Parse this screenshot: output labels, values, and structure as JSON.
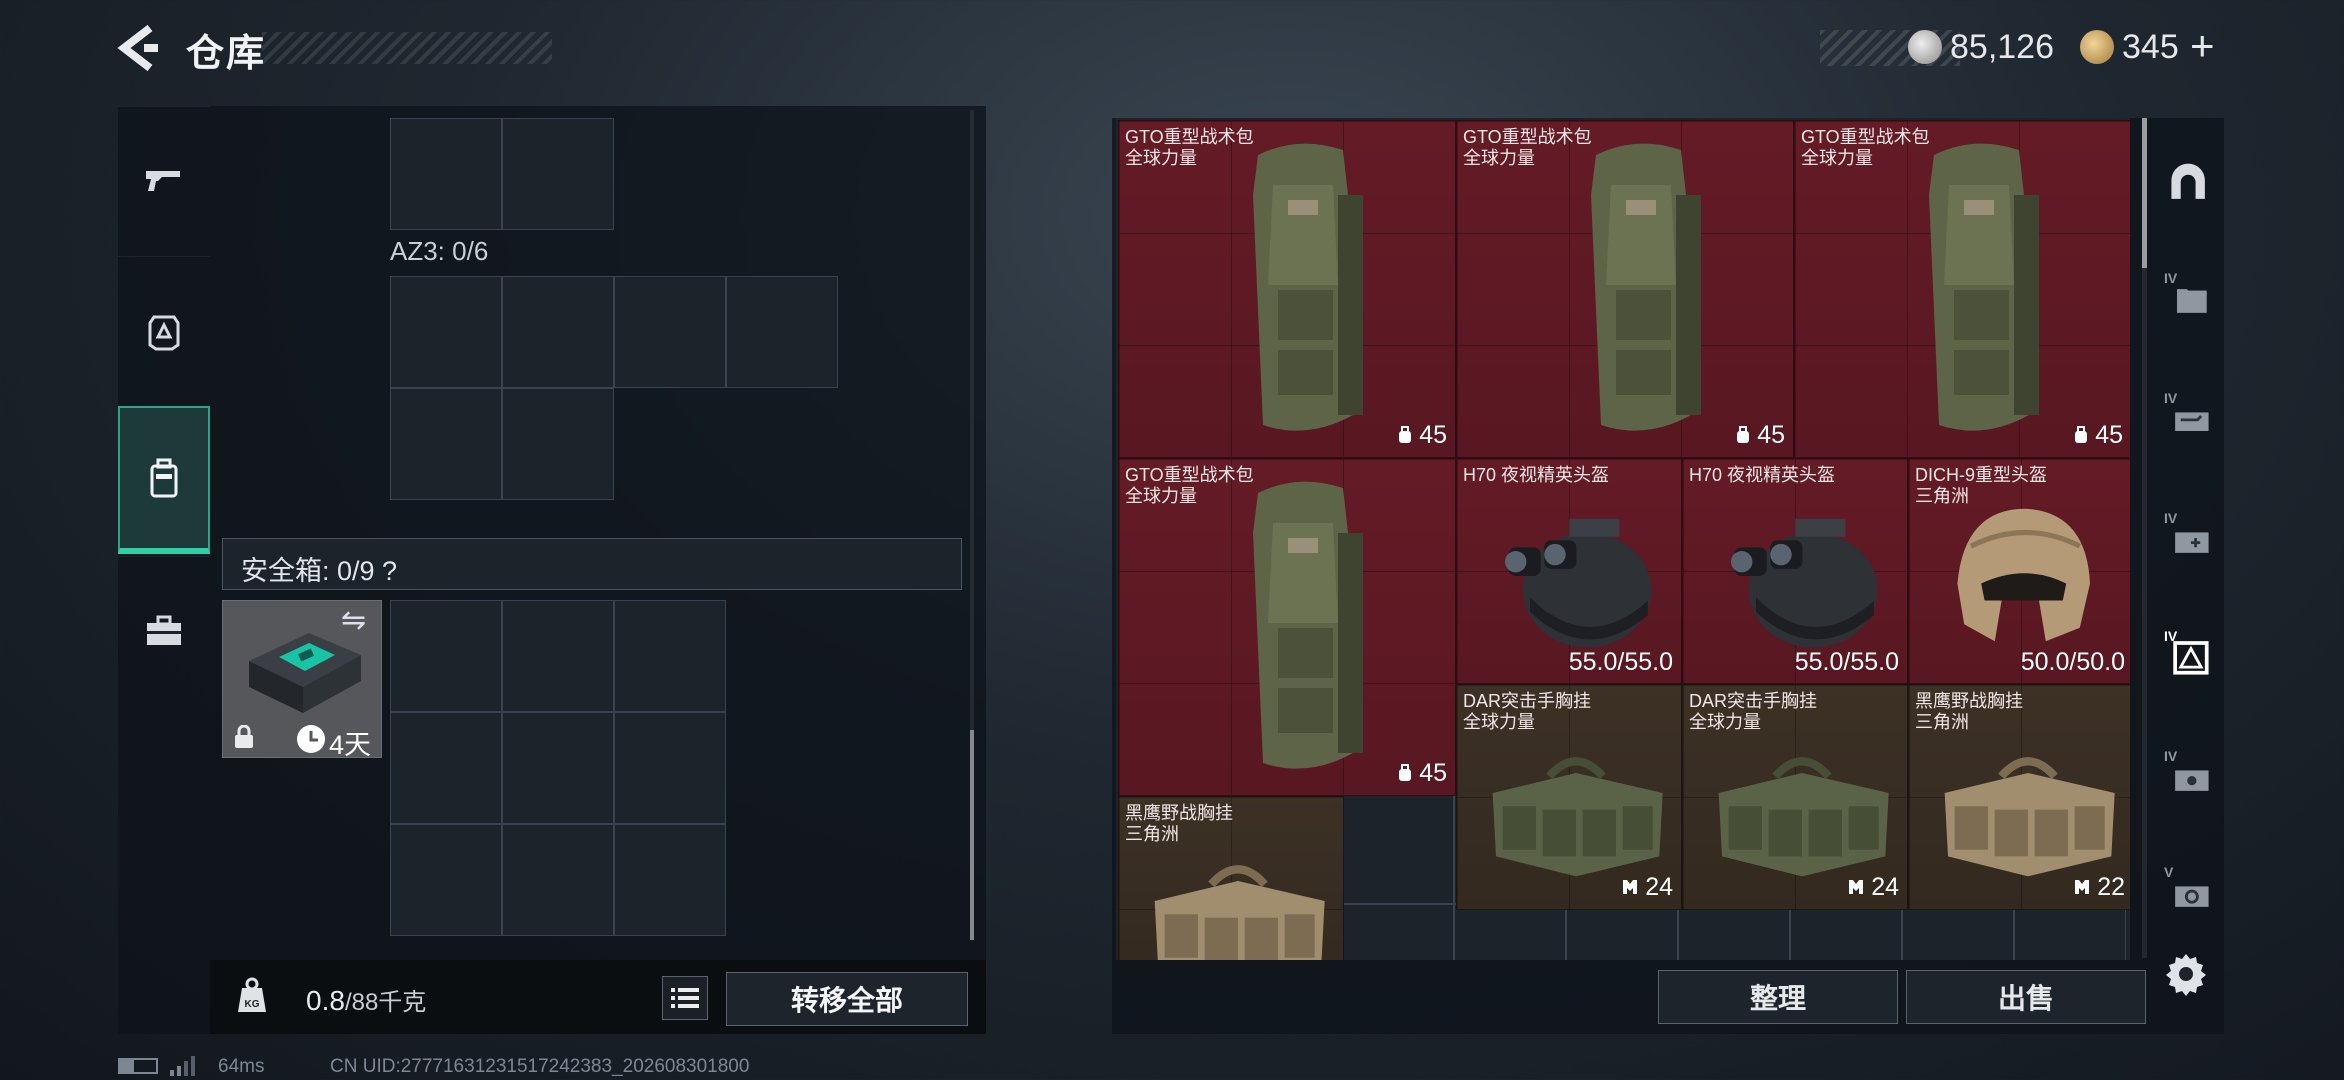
{
  "header": {
    "title": "仓库",
    "currency": [
      {
        "icon": "silver-coin-icon",
        "value": "85,126"
      },
      {
        "icon": "gold-coin-icon",
        "value": "345"
      }
    ],
    "add_symbol": "+"
  },
  "left_nav": {
    "items": [
      {
        "name": "weapons-tab",
        "icon": "pistol-icon"
      },
      {
        "name": "equipment-tab",
        "icon": "armor-icon"
      },
      {
        "name": "backpack-tab",
        "icon": "backpack-icon",
        "active": true
      },
      {
        "name": "toolbox-tab",
        "icon": "briefcase-icon"
      }
    ]
  },
  "loadout": {
    "az3_label": "AZ3: 0/6",
    "safe_box_label": "安全箱: 0/9 ?",
    "safe_box_item": {
      "timer": "4天"
    }
  },
  "bottom_bar": {
    "weight_current": "0.8",
    "weight_max": "/88千克",
    "transfer_all": "转移全部"
  },
  "stash": {
    "items": [
      {
        "name": "GTO重型战术包",
        "sub": "全球力量",
        "stat": "45",
        "stat_icon": "backpack-capacity-icon",
        "color": "red",
        "art": "backpack"
      },
      {
        "name": "GTO重型战术包",
        "sub": "全球力量",
        "stat": "45",
        "stat_icon": "backpack-capacity-icon",
        "color": "red",
        "art": "backpack"
      },
      {
        "name": "GTO重型战术包",
        "sub": "全球力量",
        "stat": "45",
        "stat_icon": "backpack-capacity-icon",
        "color": "red",
        "art": "backpack"
      },
      {
        "name": "GTO重型战术包",
        "sub": "全球力量",
        "stat": "45",
        "stat_icon": "backpack-capacity-icon",
        "color": "red",
        "art": "backpack"
      },
      {
        "name": "H70 夜视精英头盔",
        "sub": "",
        "stat": "55.0/55.0",
        "color": "red",
        "art": "nvg-helmet"
      },
      {
        "name": "H70 夜视精英头盔",
        "sub": "",
        "stat": "55.0/55.0",
        "color": "red",
        "art": "nvg-helmet"
      },
      {
        "name": "DICH-9重型头盔",
        "sub": "三角洲",
        "stat": "50.0/50.0",
        "color": "red",
        "art": "tan-helmet"
      },
      {
        "name": "DAR突击手胸挂",
        "sub": "全球力量",
        "stat": "24",
        "stat_icon": "vest-capacity-icon",
        "color": "brown",
        "art": "green-rig"
      },
      {
        "name": "DAR突击手胸挂",
        "sub": "全球力量",
        "stat": "24",
        "stat_icon": "vest-capacity-icon",
        "color": "brown",
        "art": "green-rig"
      },
      {
        "name": "黑鹰野战胸挂",
        "sub": "三角洲",
        "stat": "22",
        "stat_icon": "vest-capacity-icon",
        "color": "brown",
        "art": "tan-rig"
      },
      {
        "name": "黑鹰野战胸挂",
        "sub": "三角洲",
        "stat": "",
        "color": "brown",
        "art": "tan-rig"
      }
    ],
    "sort_label": "整理",
    "sell_label": "出售"
  },
  "right_nav": {
    "items": [
      {
        "name": "hideout-tab",
        "icon": "bunker-icon"
      },
      {
        "name": "iv-1-tab",
        "icon": "folder-icon",
        "tier": "IV"
      },
      {
        "name": "iv-2-tab",
        "icon": "weapon-case-icon",
        "tier": "IV"
      },
      {
        "name": "iv-3-tab",
        "icon": "medical-case-icon",
        "tier": "IV"
      },
      {
        "name": "iv-4-tab",
        "icon": "delta-case-icon",
        "tier": "IV",
        "active": true
      },
      {
        "name": "iv-5-tab",
        "icon": "key-case-icon",
        "tier": "IV"
      },
      {
        "name": "v-tab",
        "icon": "coin-case-icon",
        "tier": "V"
      }
    ]
  },
  "status": {
    "ping": "64ms",
    "uid": "CN UID:27771631231517242383_202608301800"
  },
  "colors": {
    "accent": "#2fd0a8",
    "item_red": "#641b26",
    "item_brown": "#3d3126"
  }
}
